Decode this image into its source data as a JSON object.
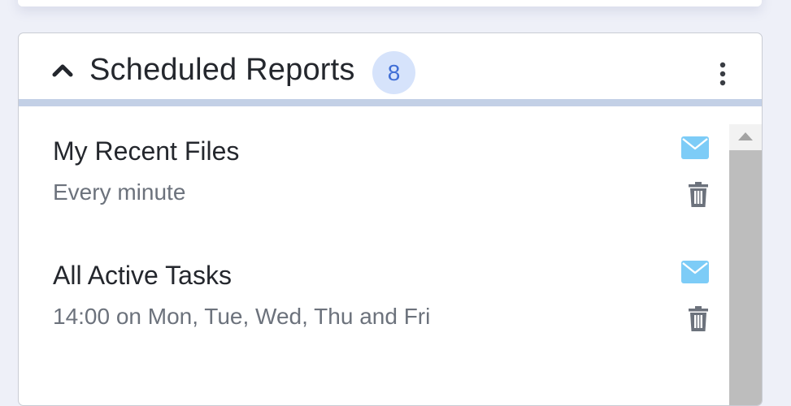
{
  "panel": {
    "title": "Scheduled Reports",
    "count": "8"
  },
  "reports": [
    {
      "name": "My Recent Files",
      "schedule": "Every minute"
    },
    {
      "name": "All Active Tasks",
      "schedule": "14:00 on Mon, Tue, Wed, Thu and Fri"
    }
  ],
  "icons": {
    "collapse": "chevron-up-icon",
    "more": "more-vertical-icon",
    "email": "mail-icon",
    "delete": "trash-icon"
  },
  "colors": {
    "badge_bg": "#d6e3fb",
    "badge_text": "#3f6ed6",
    "header_divider": "#c3d0e6",
    "mail_icon": "#7dccf7",
    "trash_icon": "#6c727c"
  }
}
